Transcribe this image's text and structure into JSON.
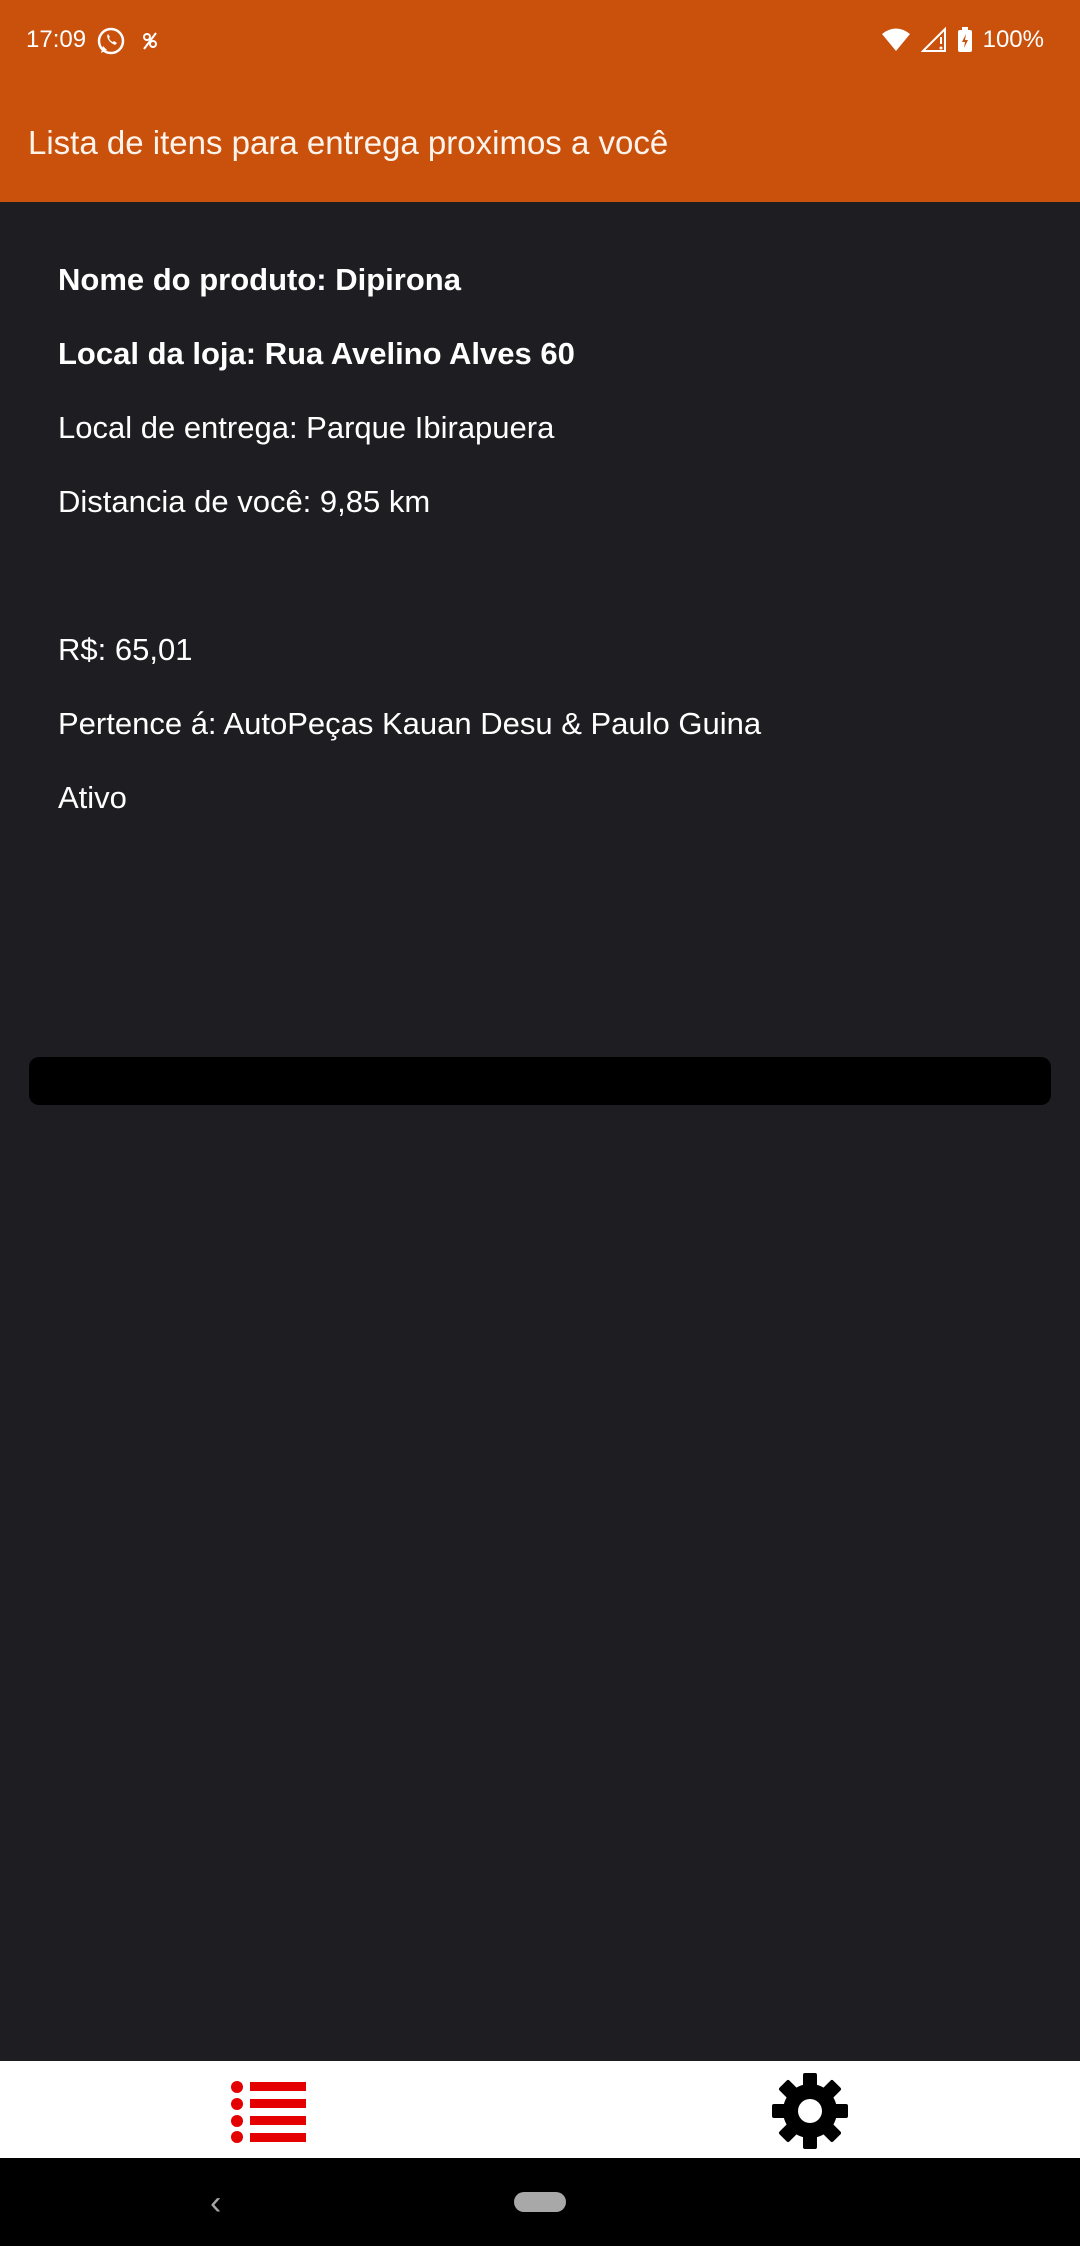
{
  "status_bar": {
    "time": "17:09",
    "battery": "100%",
    "icons": [
      "whatsapp-icon",
      "notification-icon",
      "wifi-icon",
      "signal-icon",
      "battery-icon"
    ]
  },
  "app_bar": {
    "title": "Lista de itens para entrega proximos a você"
  },
  "item": {
    "product_name": "Nome do produto: Dipirona",
    "store_location": "Local da loja: Rua Avelino Alves 60",
    "delivery_location": "Local de entrega: Parque Ibirapuera",
    "distance": "Distancia de você: 9,85 km",
    "price": "R$: 65,01",
    "belongs_to": "Pertence á: AutoPeças Kauan Desu & Paulo Guina",
    "status": "Ativo"
  },
  "bottom_nav": {
    "items": [
      {
        "name": "list",
        "icon": "list-icon",
        "color": "#e40000"
      },
      {
        "name": "settings",
        "icon": "gear-icon",
        "color": "#000000"
      }
    ]
  },
  "colors": {
    "accent": "#c9510c",
    "background": "#1e1e22"
  }
}
